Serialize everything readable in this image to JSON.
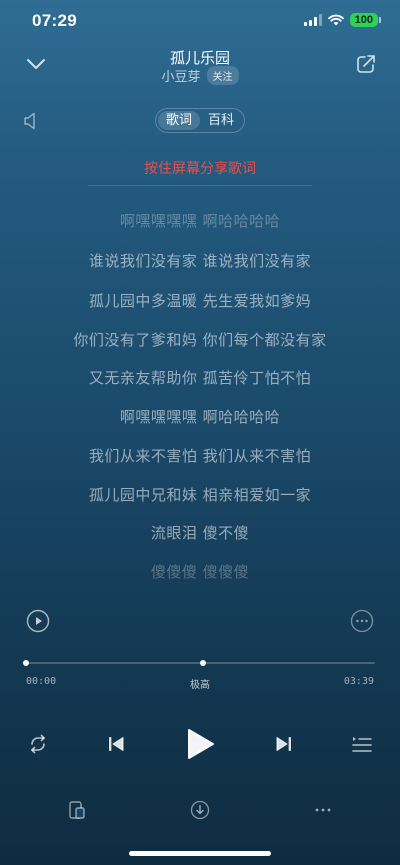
{
  "status_bar": {
    "time": "07:29",
    "battery": "100"
  },
  "header": {
    "song_title": "孤儿乐园",
    "artist": "小豆芽",
    "follow_label": "关注"
  },
  "tabs": [
    {
      "label": "歌词",
      "active": true
    },
    {
      "label": "百科",
      "active": false
    }
  ],
  "share_hint": "按住屏幕分享歌词",
  "lyrics": [
    "啊嘿嘿嘿嘿 啊哈哈哈哈",
    "谁说我们没有家 谁说我们没有家",
    "孤儿园中多温暖 先生爱我如爹妈",
    "你们没有了爹和妈 你们每个都没有家",
    "又无亲友帮助你 孤苦伶丁怕不怕",
    "啊嘿嘿嘿嘿 啊哈哈哈哈",
    "我们从来不害怕 我们从来不害怕",
    "孤儿园中兄和妹 相亲相爱如一家",
    "流眼泪 傻不傻",
    "傻傻傻 傻傻傻"
  ],
  "player": {
    "current_time": "00:00",
    "total_time": "03:39",
    "quality": "极高",
    "progress": 0.0
  },
  "colors": {
    "accent_hint": "#e8504a",
    "battery": "#30d158"
  },
  "icons": {
    "collapse": "chevron-down-icon",
    "share": "share-icon",
    "sound_effect": "speaker-icon",
    "video": "video-play-icon",
    "more_circle": "more-circle-icon",
    "repeat": "repeat-icon",
    "prev": "previous-icon",
    "play": "play-icon",
    "next": "next-icon",
    "playlist": "playlist-icon",
    "device": "device-switch-icon",
    "download": "download-icon",
    "more": "more-dots-icon"
  }
}
